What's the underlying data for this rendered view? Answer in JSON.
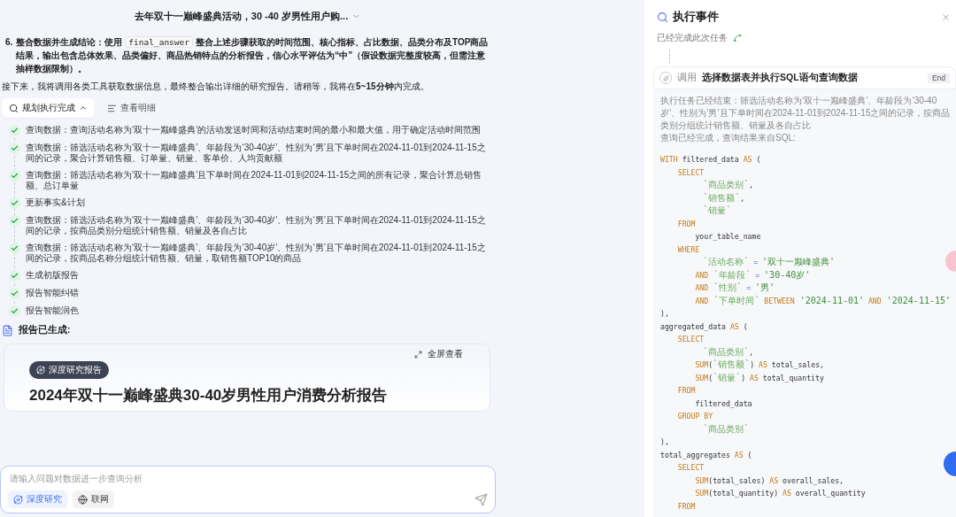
{
  "header": {
    "title": "去年双十一巅峰盛典活动，30 -40 岁男性用户购..."
  },
  "plan": {
    "number": "6.",
    "lead": "整合数据并生成结论：使用",
    "code": "final_answer",
    "rest": "整合上述步骤获取的时间范围、核心指标、占比数据、品类分布及TOP商品结果，输出包含总体效果、品类偏好、商品热销特点的分析报告，信心水平评估为“中”（假设数据完整度较高，但需注意抽样数据限制）。"
  },
  "notice": "接下来，我将调用各类工具获取数据信息，最终整合输出详细的研究报告。请稍等，我将在**5~15分钟**内完成。",
  "toolbar": {
    "status_button": "规划执行完成",
    "expanded": true,
    "detail_button": "查看明细"
  },
  "steps": [
    {
      "text": "查询数据：查询活动名称为‘双十一巅峰盛典’的活动发送时间和活动结束时间的最小和最大值，用于确定活动时间范围",
      "done": true
    },
    {
      "text": "查询数据：筛选活动名称为‘双十一巅峰盛典’、年龄段为‘30-40岁’、性别为‘男’且下单时间在2024-11-01到2024-11-15之间的记录，聚合计算销售额、订单量、销量、客单价、人均贡献额",
      "done": true
    },
    {
      "text": "查询数据：筛选活动名称为‘双十一巅峰盛典’且下单时间在2024-11-01到2024-11-15之间的所有记录，聚合计算总销售额、总订单量",
      "done": true
    },
    {
      "text": "更新事实&计划",
      "done": true
    },
    {
      "text": "查询数据：筛选活动名称为‘双十一巅峰盛典’、年龄段为‘30-40岁’、性别为‘男’且下单时间在2024-11-01到2024-11-15之间的记录，按商品类别分组统计销售额、销量及各自占比",
      "done": true
    },
    {
      "text": "查询数据：筛选活动名称为‘双十一巅峰盛典’、年龄段为‘30-40岁’、性别为‘男’且下单时间在2024-11-01到2024-11-15之间的记录，按商品名称分组统计销售额、销量，取销售额TOP10的商品",
      "done": true
    },
    {
      "text": "生成初版报告",
      "done": true
    },
    {
      "text": "报告智能纠错",
      "done": true
    },
    {
      "text": "报告智能润色",
      "done": true
    }
  ],
  "report": {
    "heading": "报告已生成:",
    "fullscreen": "全屏查看",
    "badge": "深度研究报告",
    "title": "2024年双十一巅峰盛典30-40岁男性用户消费分析报告"
  },
  "composer": {
    "placeholder": "请输入问题对数据进一步查询分析",
    "chips": [
      {
        "label": "深度研究",
        "selected": true
      },
      {
        "label": "联网",
        "selected": false
      }
    ]
  },
  "events": {
    "title": "执行事件",
    "status": "已经完成此次任务",
    "call": {
      "prefix": "调用",
      "title": "选择数据表并执行SQL语句查询数据",
      "tag": "End",
      "description": "执行任务已经结束：筛选活动名称为‘双十一巅峰盛典’、年龄段为‘30-40岁’、性别为‘男’且下单时间在2024-11-01到2024-11-15之间的记录，按商品类别分组统计销售额、销量及各自占比",
      "note": "查询已经完成，查询结果来自SQL:",
      "code": [
        [
          {
            "kind": "kw",
            "text": "WITH"
          },
          {
            "kind": "plain",
            "text": " filtered_data "
          },
          {
            "kind": "kw",
            "text": "AS"
          },
          {
            "kind": "plain",
            "text": " ("
          }
        ],
        [
          {
            "kind": "kw",
            "text": "    SELECT"
          }
        ],
        [
          {
            "kind": "name",
            "text": "        `商品类别`"
          },
          {
            "kind": "plain",
            "text": ","
          }
        ],
        [
          {
            "kind": "name",
            "text": "        `销售额`"
          },
          {
            "kind": "plain",
            "text": ","
          }
        ],
        [
          {
            "kind": "name",
            "text": "        `销量`"
          }
        ],
        [
          {
            "kind": "kw",
            "text": "    FROM"
          }
        ],
        [
          {
            "kind": "plain",
            "text": "        your_table_name"
          }
        ],
        [
          {
            "kind": "kw",
            "text": "    WHERE"
          }
        ],
        [
          {
            "kind": "name",
            "text": "        `活动名称`"
          },
          {
            "kind": "op",
            "text": " = "
          },
          {
            "kind": "str",
            "text": "'双十一巅峰盛典'"
          }
        ],
        [
          {
            "kind": "kw",
            "text": "        AND"
          },
          {
            "kind": "name",
            "text": " `年龄段`"
          },
          {
            "kind": "op",
            "text": " = "
          },
          {
            "kind": "str",
            "text": "'30-40岁'"
          }
        ],
        [
          {
            "kind": "kw",
            "text": "        AND"
          },
          {
            "kind": "name",
            "text": " `性别`"
          },
          {
            "kind": "op",
            "text": " = "
          },
          {
            "kind": "str",
            "text": "'男'"
          }
        ],
        [
          {
            "kind": "kw",
            "text": "        AND"
          },
          {
            "kind": "name",
            "text": " `下单时间`"
          },
          {
            "kind": "kw",
            "text": " BETWEEN"
          },
          {
            "kind": "str",
            "text": " '2024-11-01'"
          },
          {
            "kind": "kw",
            "text": " AND"
          },
          {
            "kind": "str",
            "text": " '2024-11-15'"
          }
        ],
        [
          {
            "kind": "plain",
            "text": "),"
          }
        ],
        [
          {
            "kind": "plain",
            "text": "aggregated_data "
          },
          {
            "kind": "kw",
            "text": "AS"
          },
          {
            "kind": "plain",
            "text": " ("
          }
        ],
        [
          {
            "kind": "kw",
            "text": "    SELECT"
          }
        ],
        [
          {
            "kind": "name",
            "text": "        `商品类别`"
          },
          {
            "kind": "plain",
            "text": ","
          }
        ],
        [
          {
            "kind": "kw",
            "text": "        SUM"
          },
          {
            "kind": "plain",
            "text": "("
          },
          {
            "kind": "name",
            "text": "`销售额`"
          },
          {
            "kind": "plain",
            "text": ") "
          },
          {
            "kind": "kw",
            "text": "AS"
          },
          {
            "kind": "plain",
            "text": " total_sales,"
          }
        ],
        [
          {
            "kind": "kw",
            "text": "        SUM"
          },
          {
            "kind": "plain",
            "text": "("
          },
          {
            "kind": "name",
            "text": "`销量`"
          },
          {
            "kind": "plain",
            "text": ") "
          },
          {
            "kind": "kw",
            "text": "AS"
          },
          {
            "kind": "plain",
            "text": " total_quantity"
          }
        ],
        [
          {
            "kind": "kw",
            "text": "    FROM"
          }
        ],
        [
          {
            "kind": "plain",
            "text": "        filtered_data"
          }
        ],
        [
          {
            "kind": "kw",
            "text": "    GROUP BY"
          }
        ],
        [
          {
            "kind": "name",
            "text": "        `商品类别`"
          }
        ],
        [
          {
            "kind": "plain",
            "text": "),"
          }
        ],
        [
          {
            "kind": "plain",
            "text": "total_aggregates "
          },
          {
            "kind": "kw",
            "text": "AS"
          },
          {
            "kind": "plain",
            "text": " ("
          }
        ],
        [
          {
            "kind": "kw",
            "text": "    SELECT"
          }
        ],
        [
          {
            "kind": "kw",
            "text": "        SUM"
          },
          {
            "kind": "plain",
            "text": "(total_sales) "
          },
          {
            "kind": "kw",
            "text": "AS"
          },
          {
            "kind": "plain",
            "text": " overall_sales,"
          }
        ],
        [
          {
            "kind": "kw",
            "text": "        SUM"
          },
          {
            "kind": "plain",
            "text": "(total_quantity) "
          },
          {
            "kind": "kw",
            "text": "AS"
          },
          {
            "kind": "plain",
            "text": " overall_quantity"
          }
        ],
        [
          {
            "kind": "kw",
            "text": "    FROM"
          }
        ]
      ]
    }
  }
}
